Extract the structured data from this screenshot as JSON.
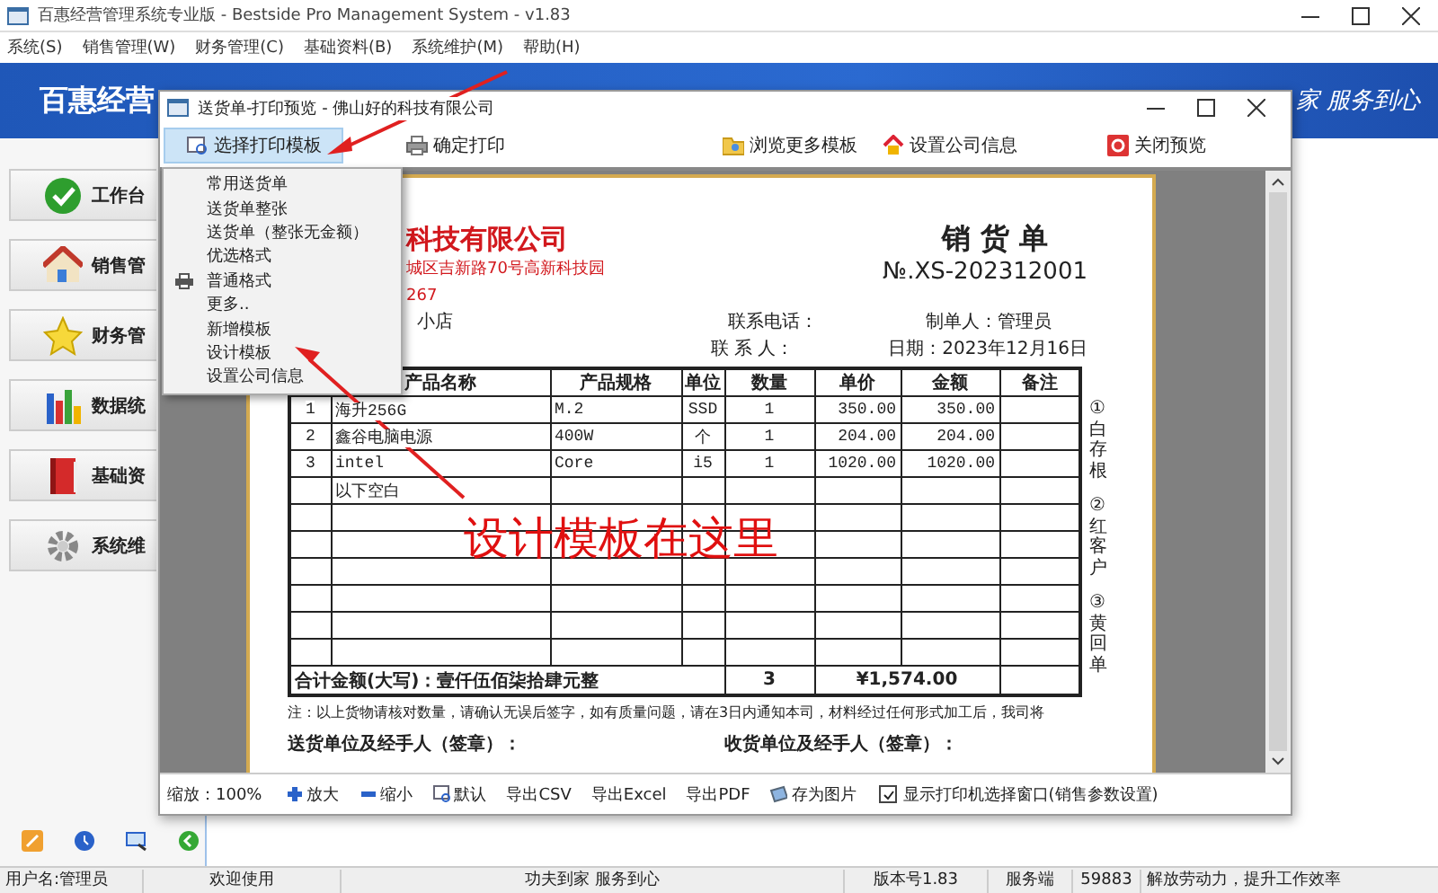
{
  "app": {
    "title": "百惠经营管理系统专业版 - Bestside Pro Management System - v1.83",
    "menu": [
      "系统(S)",
      "销售管理(W)",
      "财务管理(C)",
      "基础资料(B)",
      "系统维护(M)",
      "帮助(H)"
    ],
    "banner": {
      "title": "百惠经营",
      "slogan": "家 服务到心"
    },
    "sidebar": [
      {
        "label": "工作台"
      },
      {
        "label": "销售管"
      },
      {
        "label": "财务管"
      },
      {
        "label": "数据统"
      },
      {
        "label": "基础资"
      },
      {
        "label": "系统维"
      }
    ],
    "status_bar": [
      "用户名:管理员",
      "欢迎使用",
      "功夫到家 服务到心",
      "版本号1.83",
      "服务端",
      "59883",
      "解放劳动力，提升工作效率"
    ]
  },
  "preview": {
    "title": "送货单-打印预览 - 佛山好的科技有限公司",
    "template_button": {
      "label": "选择打印模板",
      "expanded": true
    },
    "template_menu": [
      "常用送货单",
      "送货单整张",
      "送货单（整张无金额）",
      "优选格式",
      "普通格式",
      "更多..",
      "新增模板",
      "设计模板",
      "设置公司信息"
    ],
    "toolbar": [
      "确定打印",
      "浏览更多模板",
      "设置公司信息",
      "关闭预览"
    ],
    "document": {
      "company": "科技有限公司",
      "address": "城区吉新路70号高新科技园",
      "phone": "267",
      "customer": "小店",
      "title": "销 货 单",
      "number": "№.XS-202312001",
      "contact_phone_label": "联系电话：",
      "maker": "制单人：管理员",
      "contact_label": "联 系 人：",
      "date": "日期：2023年12月16日",
      "table": {
        "columns": [
          "产品名称",
          "产品规格",
          "单位",
          "数量",
          "单价",
          "金额",
          "备注"
        ],
        "rows": [
          {
            "no": "1",
            "name": "海升256G",
            "spec": "M.2",
            "unit": "SSD",
            "qty": "1",
            "price": "350.00",
            "amount": "350.00"
          },
          {
            "no": "2",
            "name": "鑫谷电脑电源",
            "spec": "400W",
            "unit": "个",
            "qty": "1",
            "price": "204.00",
            "amount": "204.00"
          },
          {
            "no": "3",
            "name": "intel",
            "spec": "Core",
            "unit": "i5",
            "qty": "1",
            "price": "1020.00",
            "amount": "1020.00"
          },
          {
            "name": "以下空白"
          }
        ],
        "total": {
          "label": "合计金额(大写)：壹仟伍佰柒拾肆元整",
          "qty": "3",
          "amount": "¥1,574.00"
        }
      },
      "copies": [
        "①白存根",
        "②红客户",
        "③黄回单"
      ],
      "note": "注：以上货物请核对数量，请确认无误后签字，如有质量问题，请在3日内通知本司，材料经过任何形式加工后，我司将",
      "sign_sender": "送货单位及经手人（签章）：",
      "sign_receiver": "收货单位及经手人（签章）："
    },
    "bottom_bar": {
      "zoom": "缩放：100%",
      "buttons": [
        "放大",
        "缩小",
        "默认",
        "导出CSV",
        "导出Excel",
        "导出PDF",
        "存为图片"
      ],
      "checkbox": {
        "label": "显示打印机选择窗口(销售参数设置)",
        "checked": true
      }
    }
  },
  "annotation": "设计模板在这里"
}
